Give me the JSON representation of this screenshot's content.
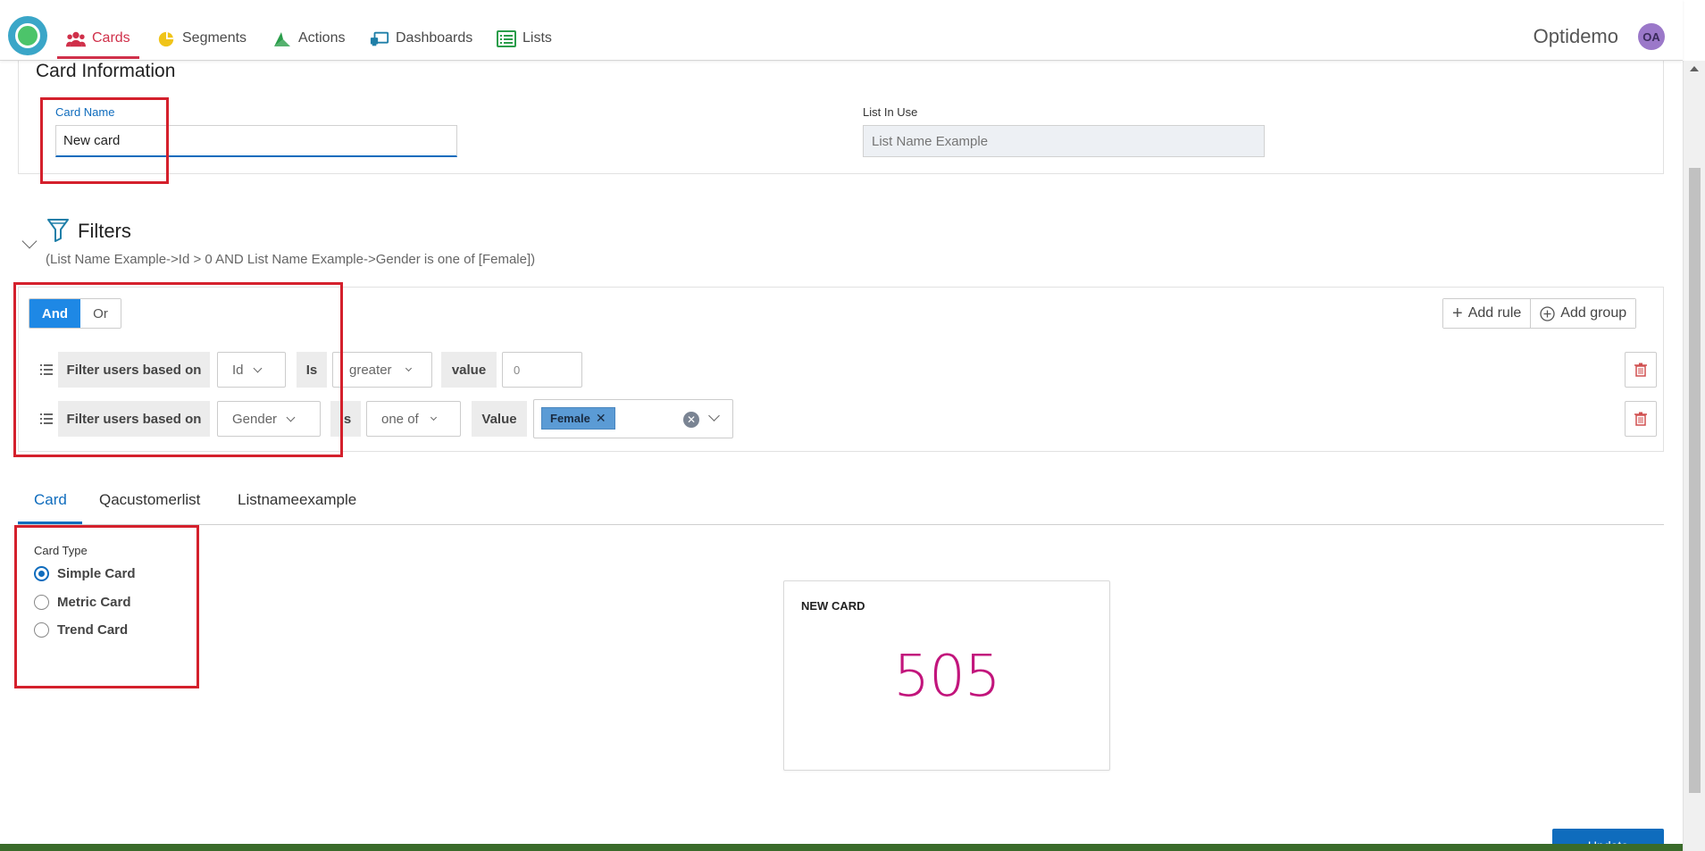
{
  "nav": {
    "items": [
      {
        "label": "Cards",
        "icon": "users-icon"
      },
      {
        "label": "Segments",
        "icon": "pie-icon"
      },
      {
        "label": "Actions",
        "icon": "actions-icon"
      },
      {
        "label": "Dashboards",
        "icon": "dashboard-icon"
      },
      {
        "label": "Lists",
        "icon": "list-icon"
      }
    ],
    "brand": "Optidemo",
    "avatar_initials": "OA",
    "accent": "#d0304a"
  },
  "card_info": {
    "title": "Card Information",
    "card_name_label": "Card Name",
    "card_name_value": "New card",
    "list_label": "List In Use",
    "list_placeholder": "List Name Example"
  },
  "filters": {
    "title": "Filters",
    "expression": "(List Name Example->Id > 0 AND List Name Example->Gender is one of [Female])",
    "combinator": {
      "and": "And",
      "or": "Or",
      "selected": "And"
    },
    "add_rule": "Add rule",
    "add_group": "Add group",
    "rules": [
      {
        "prefix": "Filter users based on",
        "field": "Id",
        "op_label": "Is",
        "operator": "greater",
        "value_label": "value",
        "value": "0"
      },
      {
        "prefix": "Filter users based on",
        "field": "Gender",
        "op_label": "Is",
        "operator": "one of",
        "value_label": "Value",
        "values": [
          "Female"
        ]
      }
    ]
  },
  "tabs": {
    "items": [
      "Card",
      "Qacustomerlist",
      "Listnameexample"
    ],
    "active": "Card"
  },
  "card_type": {
    "label": "Card Type",
    "options": [
      "Simple Card",
      "Metric Card",
      "Trend Card"
    ],
    "selected": "Simple Card"
  },
  "preview": {
    "title": "NEW CARD",
    "value": "505",
    "value_color": "#c2157c"
  },
  "footer": {
    "update_label": "Update"
  }
}
